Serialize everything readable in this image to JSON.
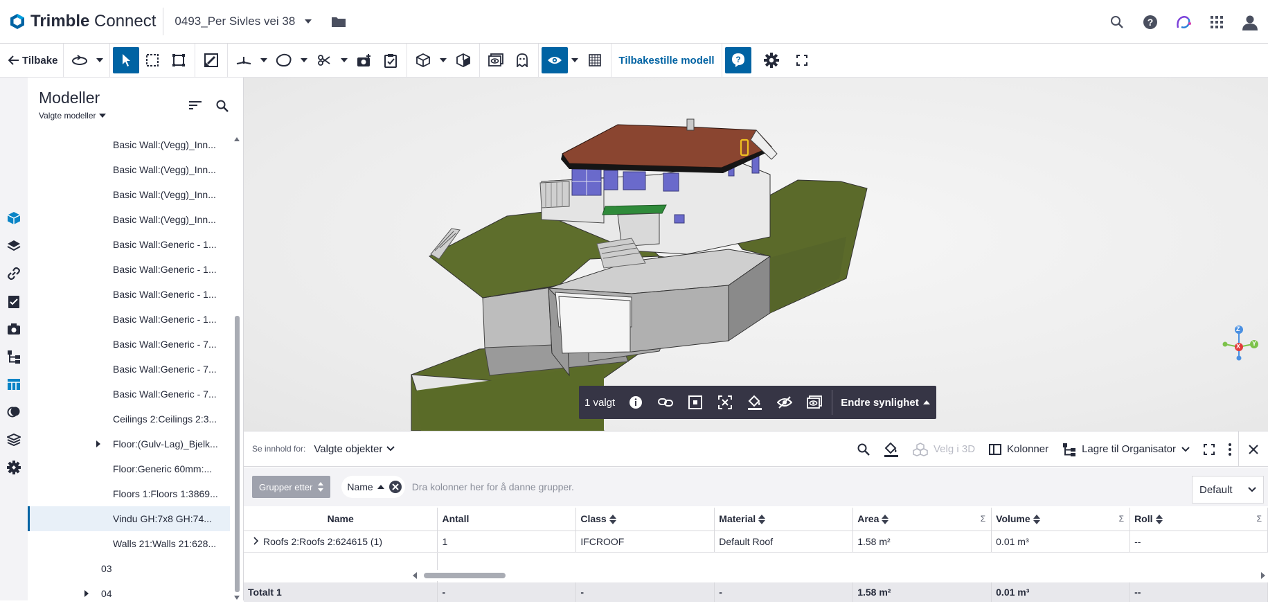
{
  "header": {
    "brand_bold": "Trimble",
    "brand_rest": "Connect",
    "project_name": "0493_Per Sivles vei 38"
  },
  "toolbar": {
    "back_label": "Tilbake",
    "reset_label": "Tilbakestille modell"
  },
  "panel": {
    "title": "Modeller",
    "subtitle": "Valgte modeller",
    "items": [
      {
        "label": "Basic Wall:(Vegg)_Inn..."
      },
      {
        "label": "Basic Wall:(Vegg)_Inn..."
      },
      {
        "label": "Basic Wall:(Vegg)_Inn..."
      },
      {
        "label": "Basic Wall:(Vegg)_Inn..."
      },
      {
        "label": "Basic Wall:Generic - 1..."
      },
      {
        "label": "Basic Wall:Generic - 1..."
      },
      {
        "label": "Basic Wall:Generic - 1..."
      },
      {
        "label": "Basic Wall:Generic - 1..."
      },
      {
        "label": "Basic Wall:Generic - 7..."
      },
      {
        "label": "Basic Wall:Generic - 7..."
      },
      {
        "label": "Basic Wall:Generic - 7..."
      },
      {
        "label": "Ceilings 2:Ceilings 2:3..."
      },
      {
        "label": "Floor:(Gulv-Lag)_Bjelk..."
      },
      {
        "label": "Floor:Generic 60mm:..."
      },
      {
        "label": "Floors 1:Floors 1:3869..."
      },
      {
        "label": "Vindu GH:7x8 GH:74..."
      },
      {
        "label": "Walls 21:Walls 21:628..."
      },
      {
        "label": "03"
      },
      {
        "label": "04"
      }
    ]
  },
  "selection": {
    "count_label": "1 valgt",
    "visibility_label": "Endre synlighet"
  },
  "viewcube": {
    "z": "Z",
    "x": "X",
    "y": "Y"
  },
  "datapanel": {
    "content_for_label": "Se innhold for:",
    "scope": "Valgte objekter",
    "select3d_label": "Velg i 3D",
    "columns_label": "Kolonner",
    "save_label": "Lagre til Organisator",
    "group_by_label": "Grupper etter",
    "group_chip": "Name",
    "drag_hint": "Dra kolonner her for å danne grupper.",
    "preset": "Default",
    "columns": [
      "Name",
      "Antall",
      "Class",
      "Material",
      "Area",
      "Volume",
      "Roll"
    ],
    "rows": [
      {
        "name": "Roofs 2:Roofs 2:624615 (1)",
        "antall": "1",
        "class": "IFCROOF",
        "material": "Default Roof",
        "area": "1.58 m²",
        "volume": "0.01 m³",
        "roll": "--"
      }
    ],
    "total": {
      "name": "Totalt 1",
      "antall": "-",
      "class": "-",
      "material": "-",
      "area": "1.58 m²",
      "volume": "0.01 m³",
      "roll": "--"
    }
  },
  "colors": {
    "accent": "#0063a3",
    "dark_toolbar": "#363545",
    "grass": "#5c6b2a",
    "roof": "#8a4530"
  }
}
